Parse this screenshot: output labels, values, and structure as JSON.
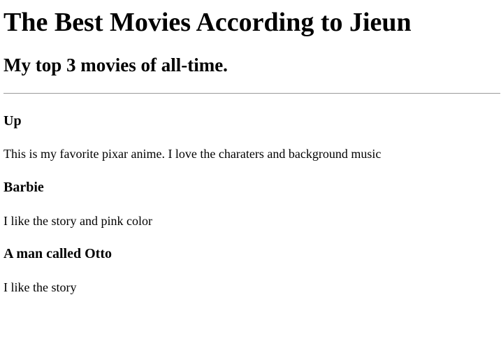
{
  "page": {
    "title": "The Best Movies According to Jieun",
    "subtitle": "My top 3 movies of all-time."
  },
  "movies": [
    {
      "title": "Up",
      "description": "This is my favorite pixar anime. I love the charaters and background music"
    },
    {
      "title": "Barbie",
      "description": "I like the story and pink color"
    },
    {
      "title": "A man called Otto",
      "description": "I like the story"
    }
  ]
}
